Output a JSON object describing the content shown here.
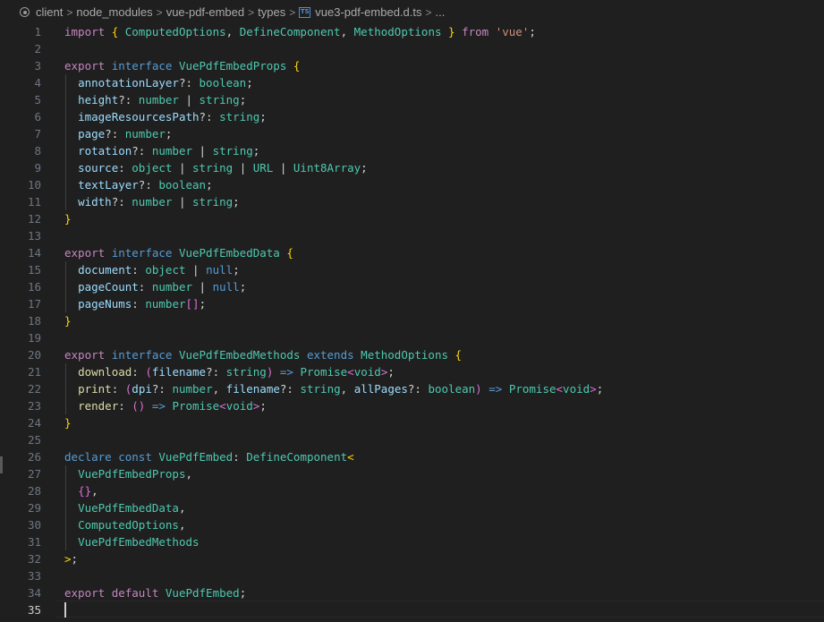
{
  "breadcrumb": {
    "items": [
      "client",
      "node_modules",
      "vue-pdf-embed",
      "types",
      "vue3-pdf-embed.d.ts",
      "..."
    ],
    "separator": ">",
    "file_badge": "TS"
  },
  "editor": {
    "active_line": 35,
    "lines": [
      {
        "n": "1",
        "tokens": [
          [
            "k",
            "import"
          ],
          [
            "o",
            " "
          ],
          [
            "y",
            "{"
          ],
          [
            "o",
            " "
          ],
          [
            "t",
            "ComputedOptions"
          ],
          [
            "o",
            ", "
          ],
          [
            "t",
            "DefineComponent"
          ],
          [
            "o",
            ", "
          ],
          [
            "t",
            "MethodOptions"
          ],
          [
            "o",
            " "
          ],
          [
            "y",
            "}"
          ],
          [
            "o",
            " "
          ],
          [
            "k",
            "from"
          ],
          [
            "o",
            " "
          ],
          [
            "str",
            "'vue'"
          ],
          [
            "o",
            ";"
          ]
        ]
      },
      {
        "n": "2",
        "tokens": []
      },
      {
        "n": "3",
        "tokens": [
          [
            "k",
            "export"
          ],
          [
            "o",
            " "
          ],
          [
            "s",
            "interface"
          ],
          [
            "o",
            " "
          ],
          [
            "t",
            "VuePdfEmbedProps"
          ],
          [
            "o",
            " "
          ],
          [
            "y",
            "{"
          ]
        ]
      },
      {
        "n": "4",
        "tokens": [
          [
            "o",
            "  "
          ],
          [
            "p",
            "annotationLayer"
          ],
          [
            "o",
            "?: "
          ],
          [
            "t",
            "boolean"
          ],
          [
            "o",
            ";"
          ]
        ]
      },
      {
        "n": "5",
        "tokens": [
          [
            "o",
            "  "
          ],
          [
            "p",
            "height"
          ],
          [
            "o",
            "?: "
          ],
          [
            "t",
            "number"
          ],
          [
            "o",
            " | "
          ],
          [
            "t",
            "string"
          ],
          [
            "o",
            ";"
          ]
        ]
      },
      {
        "n": "6",
        "tokens": [
          [
            "o",
            "  "
          ],
          [
            "p",
            "imageResourcesPath"
          ],
          [
            "o",
            "?: "
          ],
          [
            "t",
            "string"
          ],
          [
            "o",
            ";"
          ]
        ]
      },
      {
        "n": "7",
        "tokens": [
          [
            "o",
            "  "
          ],
          [
            "p",
            "page"
          ],
          [
            "o",
            "?: "
          ],
          [
            "t",
            "number"
          ],
          [
            "o",
            ";"
          ]
        ]
      },
      {
        "n": "8",
        "tokens": [
          [
            "o",
            "  "
          ],
          [
            "p",
            "rotation"
          ],
          [
            "o",
            "?: "
          ],
          [
            "t",
            "number"
          ],
          [
            "o",
            " | "
          ],
          [
            "t",
            "string"
          ],
          [
            "o",
            ";"
          ]
        ]
      },
      {
        "n": "9",
        "tokens": [
          [
            "o",
            "  "
          ],
          [
            "p",
            "source"
          ],
          [
            "o",
            ": "
          ],
          [
            "t",
            "object"
          ],
          [
            "o",
            " | "
          ],
          [
            "t",
            "string"
          ],
          [
            "o",
            " | "
          ],
          [
            "t",
            "URL"
          ],
          [
            "o",
            " | "
          ],
          [
            "t",
            "Uint8Array"
          ],
          [
            "o",
            ";"
          ]
        ]
      },
      {
        "n": "10",
        "tokens": [
          [
            "o",
            "  "
          ],
          [
            "p",
            "textLayer"
          ],
          [
            "o",
            "?: "
          ],
          [
            "t",
            "boolean"
          ],
          [
            "o",
            ";"
          ]
        ]
      },
      {
        "n": "11",
        "tokens": [
          [
            "o",
            "  "
          ],
          [
            "p",
            "width"
          ],
          [
            "o",
            "?: "
          ],
          [
            "t",
            "number"
          ],
          [
            "o",
            " | "
          ],
          [
            "t",
            "string"
          ],
          [
            "o",
            ";"
          ]
        ]
      },
      {
        "n": "12",
        "tokens": [
          [
            "y",
            "}"
          ]
        ]
      },
      {
        "n": "13",
        "tokens": []
      },
      {
        "n": "14",
        "tokens": [
          [
            "k",
            "export"
          ],
          [
            "o",
            " "
          ],
          [
            "s",
            "interface"
          ],
          [
            "o",
            " "
          ],
          [
            "t",
            "VuePdfEmbedData"
          ],
          [
            "o",
            " "
          ],
          [
            "y",
            "{"
          ]
        ]
      },
      {
        "n": "15",
        "tokens": [
          [
            "o",
            "  "
          ],
          [
            "p",
            "document"
          ],
          [
            "o",
            ": "
          ],
          [
            "t",
            "object"
          ],
          [
            "o",
            " | "
          ],
          [
            "s",
            "null"
          ],
          [
            "o",
            ";"
          ]
        ]
      },
      {
        "n": "16",
        "tokens": [
          [
            "o",
            "  "
          ],
          [
            "p",
            "pageCount"
          ],
          [
            "o",
            ": "
          ],
          [
            "t",
            "number"
          ],
          [
            "o",
            " | "
          ],
          [
            "s",
            "null"
          ],
          [
            "o",
            ";"
          ]
        ]
      },
      {
        "n": "17",
        "tokens": [
          [
            "o",
            "  "
          ],
          [
            "p",
            "pageNums"
          ],
          [
            "o",
            ": "
          ],
          [
            "t",
            "number"
          ],
          [
            "m",
            "[]"
          ],
          [
            "o",
            ";"
          ]
        ]
      },
      {
        "n": "18",
        "tokens": [
          [
            "y",
            "}"
          ]
        ]
      },
      {
        "n": "19",
        "tokens": []
      },
      {
        "n": "20",
        "tokens": [
          [
            "k",
            "export"
          ],
          [
            "o",
            " "
          ],
          [
            "s",
            "interface"
          ],
          [
            "o",
            " "
          ],
          [
            "t",
            "VuePdfEmbedMethods"
          ],
          [
            "o",
            " "
          ],
          [
            "s",
            "extends"
          ],
          [
            "o",
            " "
          ],
          [
            "t",
            "MethodOptions"
          ],
          [
            "o",
            " "
          ],
          [
            "y",
            "{"
          ]
        ]
      },
      {
        "n": "21",
        "tokens": [
          [
            "o",
            "  "
          ],
          [
            "f",
            "download"
          ],
          [
            "o",
            ": "
          ],
          [
            "m",
            "("
          ],
          [
            "p",
            "filename"
          ],
          [
            "o",
            "?: "
          ],
          [
            "t",
            "string"
          ],
          [
            "m",
            ")"
          ],
          [
            "o",
            " "
          ],
          [
            "s",
            "=>"
          ],
          [
            "o",
            " "
          ],
          [
            "t",
            "Promise"
          ],
          [
            "m",
            "<"
          ],
          [
            "t",
            "void"
          ],
          [
            "m",
            ">"
          ],
          [
            "o",
            ";"
          ]
        ]
      },
      {
        "n": "22",
        "tokens": [
          [
            "o",
            "  "
          ],
          [
            "f",
            "print"
          ],
          [
            "o",
            ": "
          ],
          [
            "m",
            "("
          ],
          [
            "p",
            "dpi"
          ],
          [
            "o",
            "?: "
          ],
          [
            "t",
            "number"
          ],
          [
            "o",
            ", "
          ],
          [
            "p",
            "filename"
          ],
          [
            "o",
            "?: "
          ],
          [
            "t",
            "string"
          ],
          [
            "o",
            ", "
          ],
          [
            "p",
            "allPages"
          ],
          [
            "o",
            "?: "
          ],
          [
            "t",
            "boolean"
          ],
          [
            "m",
            ")"
          ],
          [
            "o",
            " "
          ],
          [
            "s",
            "=>"
          ],
          [
            "o",
            " "
          ],
          [
            "t",
            "Promise"
          ],
          [
            "m",
            "<"
          ],
          [
            "t",
            "void"
          ],
          [
            "m",
            ">"
          ],
          [
            "o",
            ";"
          ]
        ]
      },
      {
        "n": "23",
        "tokens": [
          [
            "o",
            "  "
          ],
          [
            "f",
            "render"
          ],
          [
            "o",
            ": "
          ],
          [
            "m",
            "()"
          ],
          [
            "o",
            " "
          ],
          [
            "s",
            "=>"
          ],
          [
            "o",
            " "
          ],
          [
            "t",
            "Promise"
          ],
          [
            "m",
            "<"
          ],
          [
            "t",
            "void"
          ],
          [
            "m",
            ">"
          ],
          [
            "o",
            ";"
          ]
        ]
      },
      {
        "n": "24",
        "tokens": [
          [
            "y",
            "}"
          ]
        ]
      },
      {
        "n": "25",
        "tokens": []
      },
      {
        "n": "26",
        "tokens": [
          [
            "s",
            "declare"
          ],
          [
            "o",
            " "
          ],
          [
            "s",
            "const"
          ],
          [
            "o",
            " "
          ],
          [
            "t",
            "VuePdfEmbed"
          ],
          [
            "o",
            ": "
          ],
          [
            "t",
            "DefineComponent"
          ],
          [
            "y",
            "<"
          ]
        ]
      },
      {
        "n": "27",
        "tokens": [
          [
            "o",
            "  "
          ],
          [
            "t",
            "VuePdfEmbedProps"
          ],
          [
            "o",
            ","
          ]
        ]
      },
      {
        "n": "28",
        "tokens": [
          [
            "o",
            "  "
          ],
          [
            "m",
            "{}"
          ],
          [
            "o",
            ","
          ]
        ]
      },
      {
        "n": "29",
        "tokens": [
          [
            "o",
            "  "
          ],
          [
            "t",
            "VuePdfEmbedData"
          ],
          [
            "o",
            ","
          ]
        ]
      },
      {
        "n": "30",
        "tokens": [
          [
            "o",
            "  "
          ],
          [
            "t",
            "ComputedOptions"
          ],
          [
            "o",
            ","
          ]
        ]
      },
      {
        "n": "31",
        "tokens": [
          [
            "o",
            "  "
          ],
          [
            "t",
            "VuePdfEmbedMethods"
          ]
        ]
      },
      {
        "n": "32",
        "tokens": [
          [
            "y",
            ">"
          ],
          [
            "o",
            ";"
          ]
        ]
      },
      {
        "n": "33",
        "tokens": []
      },
      {
        "n": "34",
        "tokens": [
          [
            "k",
            "export"
          ],
          [
            "o",
            " "
          ],
          [
            "k",
            "default"
          ],
          [
            "o",
            " "
          ],
          [
            "t",
            "VuePdfEmbed"
          ],
          [
            "o",
            ";"
          ]
        ]
      },
      {
        "n": "35",
        "tokens": []
      }
    ]
  }
}
